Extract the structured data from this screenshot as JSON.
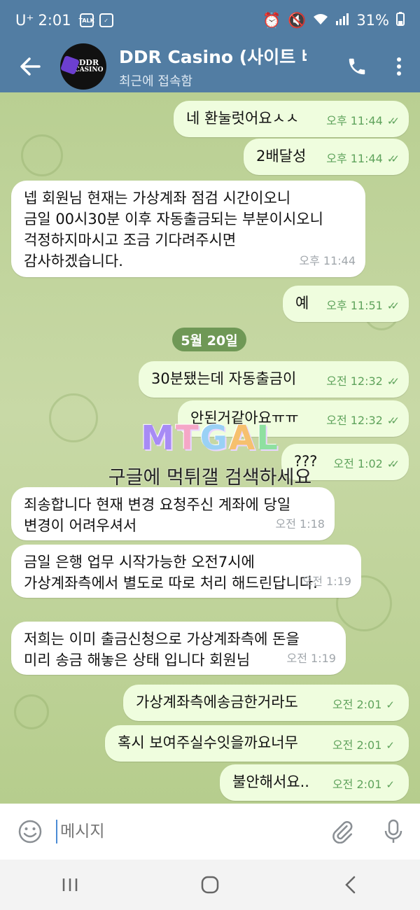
{
  "status_bar": {
    "carrier": "U⁺",
    "time": "2:01",
    "talk_icon_label": "TALK",
    "battery": "31%"
  },
  "header": {
    "title": "DDR Casino (사이트 배",
    "subtitle": "최근에 접속함",
    "avatar_text_line1": "DDR",
    "avatar_text_line2": "CASINO"
  },
  "messages": [
    {
      "dir": "out",
      "text": "네 환눌럿어요ㅅㅅ",
      "time": "오후 11:44"
    },
    {
      "dir": "out",
      "text": "2배달성",
      "time": "오후 11:44"
    },
    {
      "dir": "in",
      "text": "넵 회원님 현재는 가상계좌 점검 시간이오니\n금일 00시30분 이후 자동출금되는 부분이시오니\n걱정하지마시고 조금 기다려주시면\n감사하겠습니다.",
      "time": "오후 11:44"
    },
    {
      "dir": "out",
      "text": "예",
      "time": "오후 11:51"
    },
    {
      "dir": "out",
      "text": "30분됐는데 자동출금이",
      "time": "오전 12:32"
    },
    {
      "dir": "out",
      "text": "안된거같아요ㅠㅠ",
      "time": "오전 12:32"
    },
    {
      "dir": "out",
      "text": "???",
      "time": "오전 1:02"
    },
    {
      "dir": "in",
      "text": "죄송합니다 현재 변경 요청주신 계좌에 당일\n변경이 어려우셔서",
      "time": "오전 1:18"
    },
    {
      "dir": "in",
      "text": "금일 은행 업무 시작가능한 오전7시에\n가상계좌측에서 별도로 따로 처리 해드린답니다.",
      "time": "오전 1:19"
    },
    {
      "dir": "in",
      "text": "저희는 이미 출금신청으로 가상계좌측에 돈을\n미리 송금 해놓은 상태 입니다 회원님",
      "time": "오전 1:19"
    },
    {
      "dir": "out",
      "text": "가상계좌측에송금한거라도",
      "time": "오전 2:01"
    },
    {
      "dir": "out",
      "text": "혹시 보여주실수잇을까요너무",
      "time": "오전 2:01"
    },
    {
      "dir": "out",
      "text": "불안해서요..",
      "time": "오전 2:01"
    }
  ],
  "date_separator": "5월 20일",
  "watermark": {
    "logo": [
      "M",
      "T",
      "G",
      "A",
      "L"
    ],
    "text": "구글에 먹튀갤 검색하세요"
  },
  "input": {
    "placeholder": "메시지"
  },
  "colors": {
    "header": "#527da3",
    "outgoing_bubble": "#effdde",
    "incoming_bubble": "#ffffff",
    "read_ticks": "#5fa35c"
  }
}
